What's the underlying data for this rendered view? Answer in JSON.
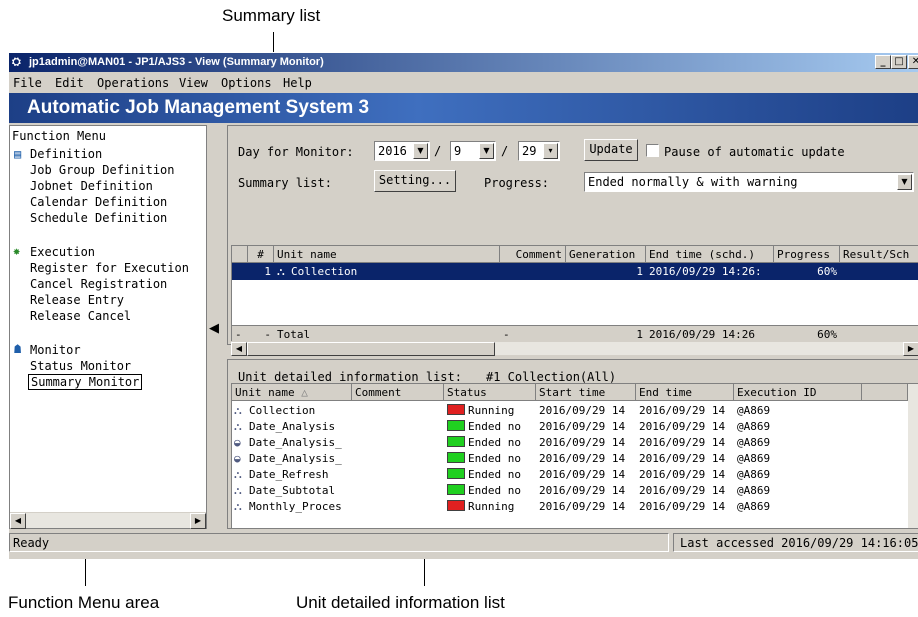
{
  "callouts": {
    "summary_list": "Summary list",
    "function_menu_area": "Function Menu area",
    "unit_detailed_information_list": "Unit detailed information list"
  },
  "window": {
    "title": "jp1admin@MAN01 - JP1/AJS3 - View (Summary Monitor)",
    "min": "_",
    "max": "□",
    "close": "✕"
  },
  "menu": [
    "File",
    "Edit",
    "Operations",
    "View",
    "Options",
    "Help"
  ],
  "banner": "Automatic Job Management System 3",
  "function_menu": {
    "header": "Function Menu",
    "definition": {
      "title": "Definition",
      "items": [
        "Job Group Definition",
        "Jobnet Definition",
        "Calendar Definition",
        "Schedule Definition"
      ]
    },
    "execution": {
      "title": "Execution",
      "items": [
        "Register for Execution",
        "Cancel Registration",
        "Release Entry",
        "Release Cancel"
      ]
    },
    "monitor": {
      "title": "Monitor",
      "items": [
        "Status Monitor",
        "Summary Monitor"
      ]
    }
  },
  "summary": {
    "day_label": "Day for Monitor:",
    "year": "2016",
    "month": "9",
    "day": "29",
    "sep": "/",
    "update_button": "Update",
    "pause_label": "Pause of automatic update",
    "summary_list_label": "Summary list:",
    "setting_button": "Setting...",
    "progress_label": "Progress:",
    "progress_value": "Ended normally & with warning",
    "columns": [
      "#",
      "Unit name",
      "Comment",
      "Generation",
      "End time (schd.)",
      "Progress",
      "Result/Sch"
    ],
    "row": {
      "num": "1",
      "unit": "Collection",
      "comment": "",
      "generation": "1",
      "end": "2016/09/29 14:26:",
      "progress": "60%"
    },
    "total": {
      "c0": "-",
      "c1": "-",
      "label": "Total",
      "comment": "-",
      "generation": "1",
      "end": "2016/09/29 14:26",
      "progress": "60%"
    }
  },
  "details": {
    "title": "Unit detailed information list:",
    "target": "#1 Collection(All)",
    "columns": [
      "Unit name",
      "Comment",
      "Status",
      "Start time",
      "End time",
      "Execution ID"
    ],
    "sort_mark": "△",
    "rows": [
      {
        "icon": "jobnet",
        "name": "Collection",
        "status": "Running",
        "color": "#e02020",
        "start": "2016/09/29 14",
        "end": "2016/09/29 14",
        "id": "@A869"
      },
      {
        "icon": "jobnet",
        "name": "Date_Analysis",
        "status": "Ended no",
        "color": "#20d020",
        "start": "2016/09/29 14",
        "end": "2016/09/29 14",
        "id": "@A869"
      },
      {
        "icon": "job",
        "name": "Date_Analysis_",
        "status": "Ended no",
        "color": "#20d020",
        "start": "2016/09/29 14",
        "end": "2016/09/29 14",
        "id": "@A869"
      },
      {
        "icon": "job",
        "name": "Date_Analysis_",
        "status": "Ended no",
        "color": "#20d020",
        "start": "2016/09/29 14",
        "end": "2016/09/29 14",
        "id": "@A869"
      },
      {
        "icon": "jobnet",
        "name": "Date_Refresh",
        "status": "Ended no",
        "color": "#20d020",
        "start": "2016/09/29 14",
        "end": "2016/09/29 14",
        "id": "@A869"
      },
      {
        "icon": "jobnet",
        "name": "Date_Subtotal",
        "status": "Ended no",
        "color": "#20d020",
        "start": "2016/09/29 14",
        "end": "2016/09/29 14",
        "id": "@A869"
      },
      {
        "icon": "jobnet",
        "name": "Monthly_Proces",
        "status": "Running",
        "color": "#e02020",
        "start": "2016/09/29 14",
        "end": "2016/09/29 14",
        "id": "@A869"
      }
    ]
  },
  "status_bar": {
    "left": "Ready",
    "right": "Last accessed 2016/09/29 14:16:05"
  }
}
